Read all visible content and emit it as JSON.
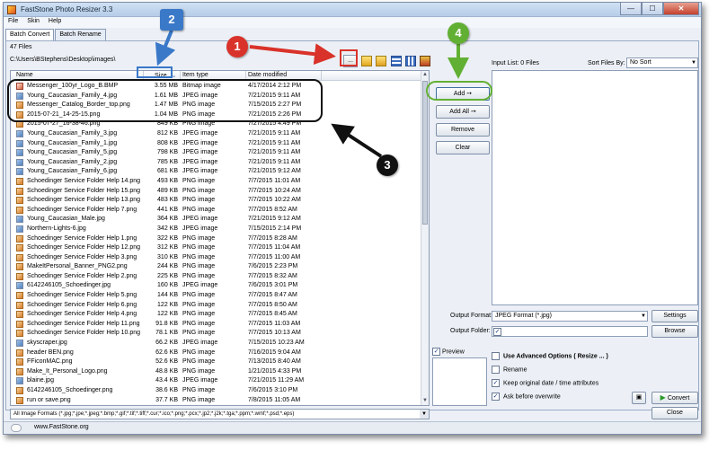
{
  "window": {
    "title": "FastStone Photo Resizer 3.3",
    "controls": [
      "—",
      "☐",
      "✕"
    ]
  },
  "menu": [
    "File",
    "Skin",
    "Help"
  ],
  "tabs": [
    "Batch Convert",
    "Batch Rename"
  ],
  "browser": {
    "file_count": "47 Files",
    "path": "C:\\Users\\BStephens\\Desktop\\images\\",
    "browse_label": "...",
    "columns": {
      "name": "Name",
      "size": "Size",
      "type": "Item type",
      "date": "Date modified"
    },
    "files": [
      {
        "name": "Messenger_100yr_Logo_B.BMP",
        "size": "3.55 MB",
        "type": "Bitmap image",
        "date": "4/17/2014 2:12 PM",
        "icon": "bmp"
      },
      {
        "name": "Young_Caucasian_Family_4.jpg",
        "size": "1.61 MB",
        "type": "JPEG image",
        "date": "7/21/2015 9:11 AM",
        "icon": "jpg"
      },
      {
        "name": "Messenger_Catalog_Border_top.png",
        "size": "1.47 MB",
        "type": "PNG image",
        "date": "7/15/2015 2:27 PM",
        "icon": "png"
      },
      {
        "name": "2015-07-21_14-25-15.png",
        "size": "1.04 MB",
        "type": "PNG image",
        "date": "7/21/2015 2:26 PM",
        "icon": "png"
      },
      {
        "name": "2015-07-27_16-38-46.png",
        "size": "849 KB",
        "type": "PNG image",
        "date": "7/27/2015 4:49 PM",
        "icon": "png"
      },
      {
        "name": "Young_Caucasian_Family_3.jpg",
        "size": "812 KB",
        "type": "JPEG image",
        "date": "7/21/2015 9:11 AM",
        "icon": "jpg"
      },
      {
        "name": "Young_Caucasian_Family_1.jpg",
        "size": "808 KB",
        "type": "JPEG image",
        "date": "7/21/2015 9:11 AM",
        "icon": "jpg"
      },
      {
        "name": "Young_Caucasian_Family_5.jpg",
        "size": "798 KB",
        "type": "JPEG image",
        "date": "7/21/2015 9:11 AM",
        "icon": "jpg"
      },
      {
        "name": "Young_Caucasian_Family_2.jpg",
        "size": "785 KB",
        "type": "JPEG image",
        "date": "7/21/2015 9:11 AM",
        "icon": "jpg"
      },
      {
        "name": "Young_Caucasian_Family_6.jpg",
        "size": "681 KB",
        "type": "JPEG image",
        "date": "7/21/2015 9:12 AM",
        "icon": "jpg"
      },
      {
        "name": "Schoedinger Service Folder Help 14.png",
        "size": "493 KB",
        "type": "PNG image",
        "date": "7/7/2015 11:01 AM",
        "icon": "png"
      },
      {
        "name": "Schoedinger Service Folder Help 15.png",
        "size": "489 KB",
        "type": "PNG image",
        "date": "7/7/2015 10:24 AM",
        "icon": "png"
      },
      {
        "name": "Schoedinger Service Folder Help 13.png",
        "size": "483 KB",
        "type": "PNG image",
        "date": "7/7/2015 10:22 AM",
        "icon": "png"
      },
      {
        "name": "Schoedinger Service Folder Help 7.png",
        "size": "441 KB",
        "type": "PNG image",
        "date": "7/7/2015 8:52 AM",
        "icon": "png"
      },
      {
        "name": "Young_Caucasian_Male.jpg",
        "size": "364 KB",
        "type": "JPEG image",
        "date": "7/21/2015 9:12 AM",
        "icon": "jpg"
      },
      {
        "name": "Northern-Lights-6.jpg",
        "size": "342 KB",
        "type": "JPEG image",
        "date": "7/15/2015 2:14 PM",
        "icon": "jpg"
      },
      {
        "name": "Schoedinger Service Folder Help 1.png",
        "size": "322 KB",
        "type": "PNG image",
        "date": "7/7/2015 8:28 AM",
        "icon": "png"
      },
      {
        "name": "Schoedinger Service Folder Help 12.png",
        "size": "312 KB",
        "type": "PNG image",
        "date": "7/7/2015 11:04 AM",
        "icon": "png"
      },
      {
        "name": "Schoedinger Service Folder Help 3.png",
        "size": "310 KB",
        "type": "PNG image",
        "date": "7/7/2015 11:00 AM",
        "icon": "png"
      },
      {
        "name": "MakeItPersonal_Banner_PNG2.png",
        "size": "244 KB",
        "type": "PNG image",
        "date": "7/6/2015 2:23 PM",
        "icon": "png"
      },
      {
        "name": "Schoedinger Service Folder Help 2.png",
        "size": "225 KB",
        "type": "PNG image",
        "date": "7/7/2015 8:32 AM",
        "icon": "png"
      },
      {
        "name": "6142246105_Schoedinger.jpg",
        "size": "160 KB",
        "type": "JPEG image",
        "date": "7/6/2015 3:01 PM",
        "icon": "jpg"
      },
      {
        "name": "Schoedinger Service Folder Help 5.png",
        "size": "144 KB",
        "type": "PNG image",
        "date": "7/7/2015 8:47 AM",
        "icon": "png"
      },
      {
        "name": "Schoedinger Service Folder Help 6.png",
        "size": "122 KB",
        "type": "PNG image",
        "date": "7/7/2015 8:50 AM",
        "icon": "png"
      },
      {
        "name": "Schoedinger Service Folder Help 4.png",
        "size": "122 KB",
        "type": "PNG image",
        "date": "7/7/2015 8:45 AM",
        "icon": "png"
      },
      {
        "name": "Schoedinger Service Folder Help 11.png",
        "size": "91.8 KB",
        "type": "PNG image",
        "date": "7/7/2015 11:03 AM",
        "icon": "png"
      },
      {
        "name": "Schoedinger Service Folder Help 10.png",
        "size": "78.1 KB",
        "type": "PNG image",
        "date": "7/7/2015 10:13 AM",
        "icon": "png"
      },
      {
        "name": "skyscraper.jpg",
        "size": "66.2 KB",
        "type": "JPEG image",
        "date": "7/15/2015 10:23 AM",
        "icon": "jpg"
      },
      {
        "name": "header BEN.png",
        "size": "62.6 KB",
        "type": "PNG image",
        "date": "7/16/2015 9:04 AM",
        "icon": "png"
      },
      {
        "name": "FFiconMAC.png",
        "size": "52.6 KB",
        "type": "PNG image",
        "date": "7/13/2015 8:40 AM",
        "icon": "png"
      },
      {
        "name": "Make_It_Personal_Logo.png",
        "size": "48.8 KB",
        "type": "PNG image",
        "date": "1/21/2015 4:33 PM",
        "icon": "png"
      },
      {
        "name": "blaine.jpg",
        "size": "43.4 KB",
        "type": "JPEG image",
        "date": "7/21/2015 11:29 AM",
        "icon": "jpg"
      },
      {
        "name": "6142246105_Schoedinger.png",
        "size": "38.6 KB",
        "type": "PNG image",
        "date": "7/6/2015 3:10 PM",
        "icon": "png"
      },
      {
        "name": "run or save.png",
        "size": "37.7 KB",
        "type": "PNG image",
        "date": "7/8/2015 11:05 AM",
        "icon": "png"
      },
      {
        "name": "stock-vector-rose-127538087.jpg",
        "size": "35.1 KB",
        "type": "JPEG image",
        "date": "7/7/2015 10:25 AM",
        "icon": "jpg"
      }
    ],
    "filter": "All Image Formats (*.jpg;*.jpe;*.jpeg;*.bmp;*.gif;*.tif;*.tiff;*.cur;*.ico;*.png;*.pcx;*.jp2;*.j2k;*.tga;*.ppm;*.wmf;*.psd;*.eps)"
  },
  "actions": {
    "add": "Add",
    "add_all": "Add All",
    "remove": "Remove",
    "clear": "Clear"
  },
  "input_list": {
    "label": "Input List:  0 Files",
    "sort_label": "Sort Files By:",
    "sort_value": "No Sort"
  },
  "output": {
    "format_label": "Output Format:",
    "format_value": "JPEG Format (*.jpg)",
    "settings_label": "Settings",
    "folder_label": "Output Folder:",
    "browse_label": "Browse",
    "preview_label": "Preview"
  },
  "options": {
    "advanced": "Use Advanced Options ( Resize ... )",
    "rename": "Rename",
    "keep_date": "Keep original date / time attributes",
    "ask_overwrite": "Ask before overwrite"
  },
  "checkbox_states": {
    "preview": true,
    "output_folder": true,
    "advanced": false,
    "rename": false,
    "keep_date": true,
    "ask_overwrite": true
  },
  "buttons": {
    "convert": "Convert",
    "close": "Close"
  },
  "status": {
    "url": "www.FastStone.org"
  },
  "annotations": {
    "badge1": "1",
    "badge2": "2",
    "badge3": "3",
    "badge4": "4"
  },
  "colors": {
    "annotation_red": "#d9322a",
    "annotation_blue": "#3a78c8",
    "annotation_green": "#62b033",
    "annotation_black": "#111111"
  }
}
